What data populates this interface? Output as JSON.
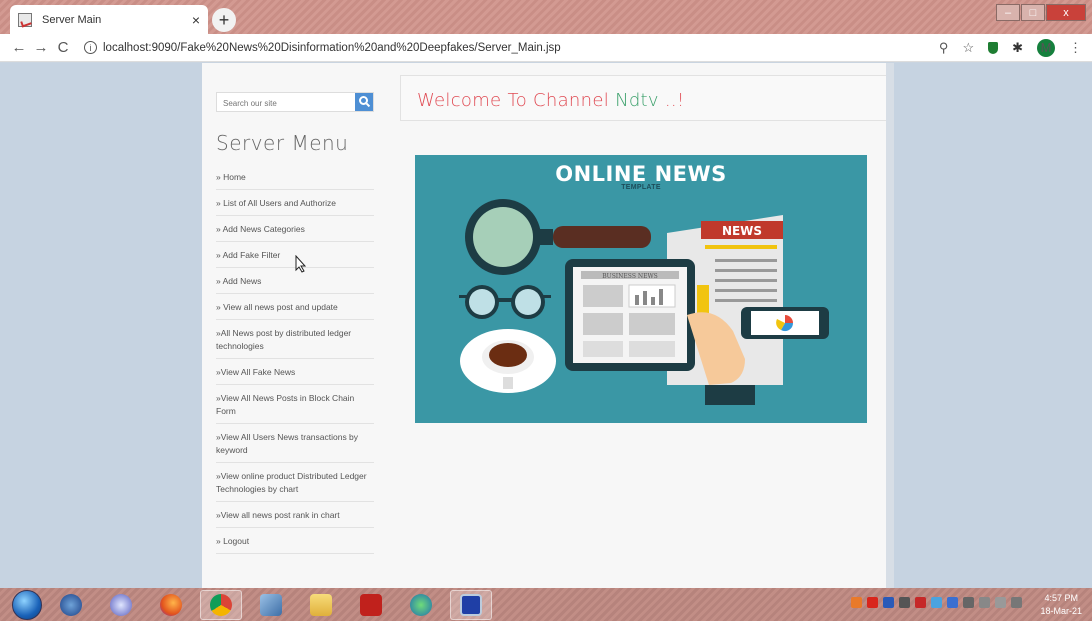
{
  "browser": {
    "tab_title": "Server Main",
    "tab_close": "×",
    "new_tab": "+",
    "url": "localhost:9090/Fake%20News%20Disinformation%20and%20Deepfakes/Server_Main.jsp",
    "back": "←",
    "forward": "→",
    "reload": "C",
    "info": "i",
    "zoom_icon": "⚲",
    "star_icon": "☆",
    "extension_icon": "✱",
    "profile_initial": "M",
    "menu_icon": "⋮",
    "win_min": "–",
    "win_max": "□",
    "win_close": "x"
  },
  "sidebar": {
    "search_placeholder": "Search our site",
    "menu_title": "Server Menu",
    "items": [
      {
        "label": "» Home"
      },
      {
        "label": "» List of All Users and Authorize"
      },
      {
        "label": "» Add News Categories"
      },
      {
        "label": "» Add Fake Filter"
      },
      {
        "label": "» Add News"
      },
      {
        "label": "» View all news post and update"
      },
      {
        "label": "»All News post by distributed ledger technologies"
      },
      {
        "label": "»View All Fake News"
      },
      {
        "label": "»View All News Posts in Block Chain Form"
      },
      {
        "label": "»View All Users News transactions by keyword"
      },
      {
        "label": "»View online product Distributed Ledger Technologies by chart"
      },
      {
        "label": "»View all news post rank in chart"
      },
      {
        "label": "» Logout"
      }
    ]
  },
  "main": {
    "welcome_pre": "Welcome To Channel ",
    "welcome_brand": "Ndtv",
    "welcome_post": " ..!",
    "hero_title": "ONLINE NEWS",
    "hero_subtitle": "TEMPLATE",
    "newspaper_label": "NEWS",
    "tablet_label": "BUSINESS NEWS"
  },
  "taskbar": {
    "time": "4:57 PM",
    "date": "18-Mar-21"
  },
  "colors": {
    "welcome_red": "#e04a53",
    "welcome_green": "#3ba06b",
    "hero_bg": "#3a97a5",
    "search_button": "#4e8fd4"
  }
}
